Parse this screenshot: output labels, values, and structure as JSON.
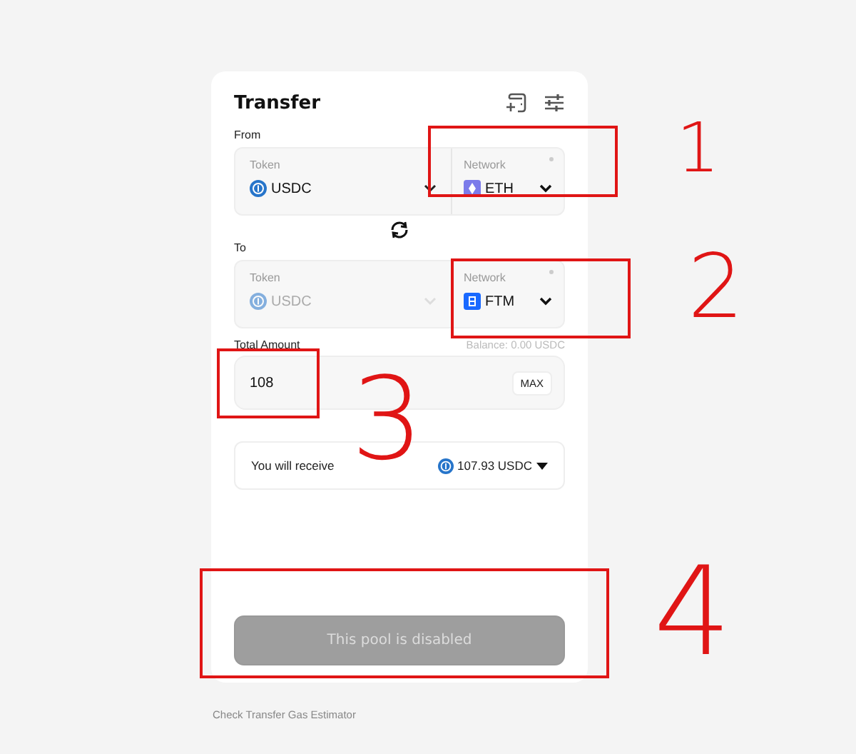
{
  "header": {
    "title": "Transfer"
  },
  "sections": [
    {
      "label": "From",
      "token": {
        "label": "Token",
        "value": "USDC",
        "disabled": false
      },
      "network": {
        "label": "Network",
        "value": "ETH"
      }
    },
    {
      "label": "To",
      "token": {
        "label": "Token",
        "value": "USDC",
        "disabled": true
      },
      "network": {
        "label": "Network",
        "value": "FTM"
      }
    }
  ],
  "amount": {
    "label": "Total Amount",
    "balance": "Balance: 0.00 USDC",
    "value": "108",
    "max_button": "MAX"
  },
  "receive": {
    "label": "You will receive",
    "value": "107.93 USDC"
  },
  "submit": {
    "label": "This pool is disabled",
    "disabled": true
  },
  "footer_link": "Check Transfer Gas Estimator",
  "annotations": [
    {
      "label": "1"
    },
    {
      "label": "2"
    },
    {
      "label": "3"
    },
    {
      "label": "4"
    }
  ]
}
